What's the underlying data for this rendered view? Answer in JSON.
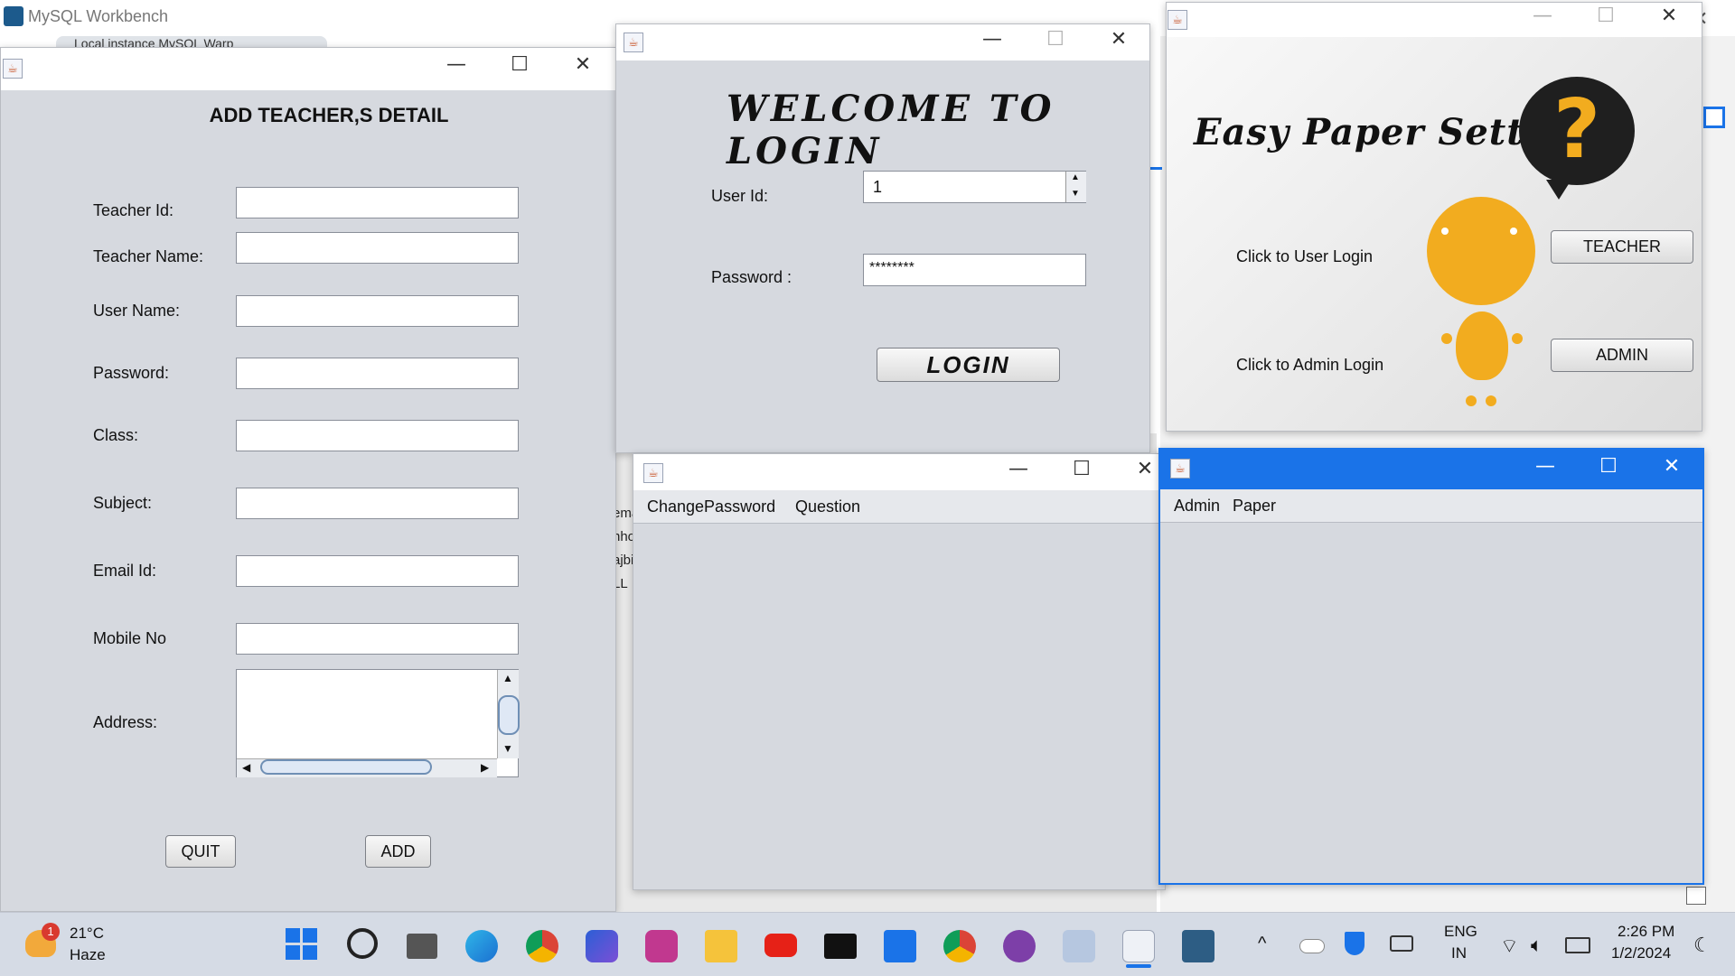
{
  "workbench": {
    "title": "MySQL Workbench",
    "tab_label": "Local instance MySQL Warp",
    "side_text": "ema\nnho\najbi\nLL"
  },
  "teacher_window": {
    "heading": "ADD TEACHER,S DETAIL",
    "fields": [
      {
        "label": "Teacher Id:",
        "value": ""
      },
      {
        "label": "Teacher Name:",
        "value": ""
      },
      {
        "label": "User Name:",
        "value": ""
      },
      {
        "label": "Password:",
        "value": ""
      },
      {
        "label": "Class:",
        "value": ""
      },
      {
        "label": "Subject:",
        "value": ""
      },
      {
        "label": "Email Id:",
        "value": ""
      },
      {
        "label": "Mobile No",
        "value": ""
      }
    ],
    "address_label": "Address:",
    "quit_label": "QUIT",
    "add_label": "ADD"
  },
  "login_window": {
    "heading": "WELCOME TO LOGIN",
    "user_id_label": "User Id:",
    "user_id_value": "1",
    "password_label": "Password :",
    "password_value": "********",
    "login_label": "LOGIN"
  },
  "setter_window": {
    "heading": "Easy Paper Setter",
    "user_login_text": "Click to User Login",
    "admin_login_text": "Click to Admin Login",
    "teacher_label": "TEACHER",
    "admin_label": "ADMIN"
  },
  "change_window": {
    "menu": [
      "ChangePassword",
      "Question"
    ]
  },
  "admin_window": {
    "menu": [
      "Admin",
      "Paper"
    ]
  },
  "taskbar": {
    "weather_temp": "21°C",
    "weather_desc": "Haze",
    "weather_badge": "1",
    "language": "ENG",
    "region": "IN",
    "time": "2:26 PM",
    "date": "1/2/2024"
  },
  "colors": {
    "accent": "#1a73e8",
    "window_bg": "#d6d9df",
    "taskbar_bg": "#d5dbe5"
  }
}
